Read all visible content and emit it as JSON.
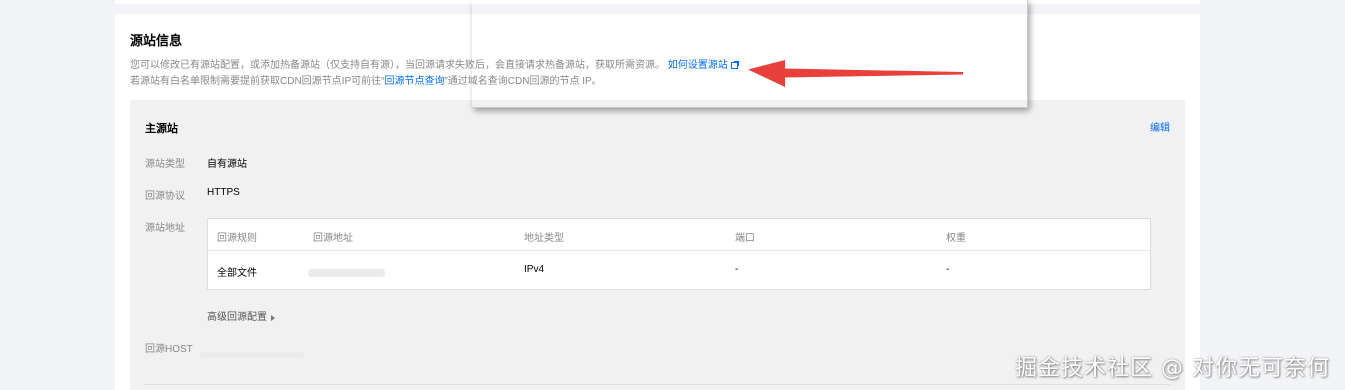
{
  "section": {
    "title": "源站信息",
    "desc_line1": "您可以修改已有源站配置，或添加热备源站（仅支持自有源），当回源请求失败后，会直接请求热备源站，获取所需资源。",
    "desc_link1": "如何设置源站",
    "desc_line2_pre": "若源站有白名单限制需要提前获取CDN回源节点IP可前往“",
    "desc_link2": "回源节点查询",
    "desc_line2_post": "”通过域名查询CDN回源的节点 IP。"
  },
  "origin": {
    "title": "主源站",
    "edit_label": "编辑",
    "type_label": "源站类型",
    "type_value": "自有源站",
    "protocol_label": "回源协议",
    "protocol_value": "HTTPS",
    "address_label": "源站地址",
    "host_label": "回源HOST",
    "advanced_label": "高级回源配置"
  },
  "table": {
    "headers": [
      "回源规则",
      "回源地址",
      "地址类型",
      "端口",
      "权重"
    ],
    "rows": [
      {
        "rule": "全部文件",
        "address": "",
        "addr_type": "IPv4",
        "port": "-",
        "weight": "-"
      }
    ]
  },
  "watermark": "掘金技术社区 @ 对你无可奈何",
  "colors": {
    "link": "#006eff",
    "arrow": "#e8403a",
    "panel_bg": "#f1f1f1"
  }
}
